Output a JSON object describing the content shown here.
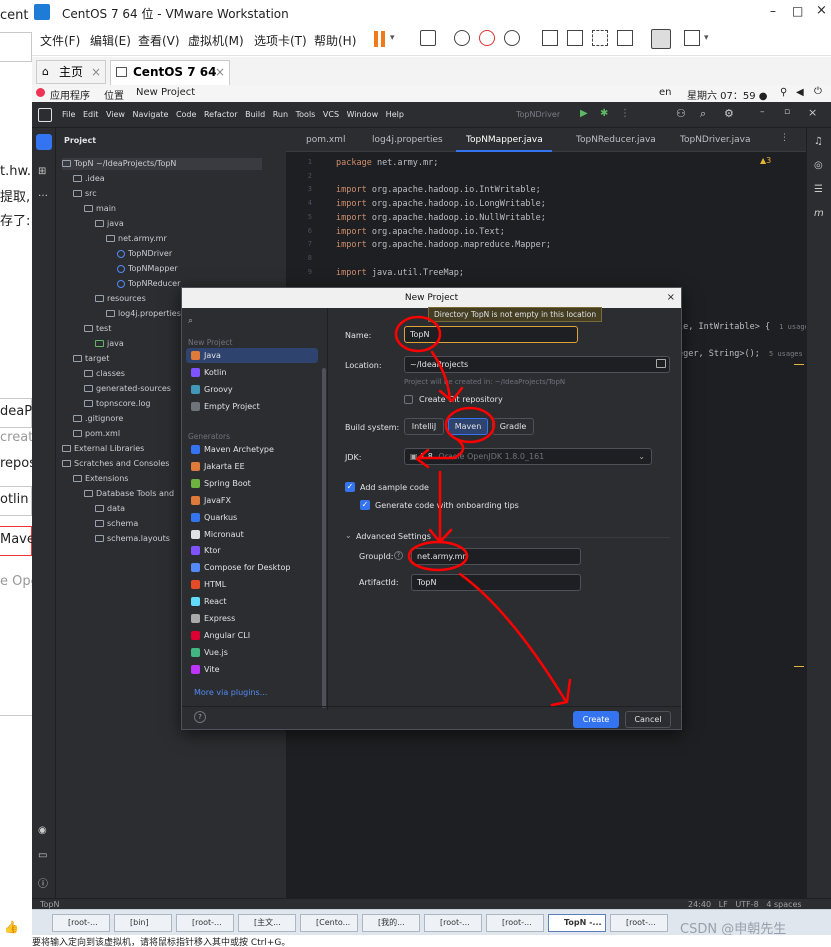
{
  "left_strip": {
    "texts": [
      "cent",
      "t.hw.",
      "提取,",
      "存了:",
      "deaPro",
      "creat",
      "repos",
      "otlin",
      "Maven",
      "e Ope"
    ]
  },
  "vmware": {
    "title": "CentOS 7 64 位 - VMware Workstation",
    "window_controls": [
      "–",
      "□",
      "×"
    ],
    "menu": [
      "文件(F)",
      "编辑(E)",
      "查看(V)",
      "虚拟机(M)",
      "选项卡(T)",
      "帮助(H)"
    ],
    "tabs": [
      {
        "label": "主页"
      },
      {
        "label": "CentOS 7 64 位",
        "active": true
      }
    ]
  },
  "gnome_bar": {
    "applications": "应用程序",
    "places": "位置",
    "active_app": "New Project",
    "lang": "en",
    "clock": "星期六 07：59 ●"
  },
  "idea": {
    "head_menu": [
      "File",
      "Edit",
      "View",
      "Navigate",
      "Code",
      "Refactor",
      "Build",
      "Run",
      "Tools",
      "VCS",
      "Window",
      "Help"
    ],
    "run_config": "TopNDriver",
    "project_title": "Project",
    "tree": [
      {
        "label": "TopN ~/IdeaProjects/TopN",
        "indent": 0,
        "kind": "folder"
      },
      {
        "label": ".idea",
        "indent": 1,
        "kind": "folder"
      },
      {
        "label": "src",
        "indent": 1,
        "kind": "folder"
      },
      {
        "label": "main",
        "indent": 2,
        "kind": "folder"
      },
      {
        "label": "java",
        "indent": 3,
        "kind": "folder"
      },
      {
        "label": "net.army.mr",
        "indent": 4,
        "kind": "package"
      },
      {
        "label": "TopNDriver",
        "indent": 5,
        "kind": "class"
      },
      {
        "label": "TopNMapper",
        "indent": 5,
        "kind": "class"
      },
      {
        "label": "TopNReducer",
        "indent": 5,
        "kind": "class"
      },
      {
        "label": "resources",
        "indent": 3,
        "kind": "folder"
      },
      {
        "label": "log4j.properties",
        "indent": 4,
        "kind": "file"
      },
      {
        "label": "test",
        "indent": 2,
        "kind": "folder"
      },
      {
        "label": "java",
        "indent": 3,
        "kind": "folder"
      },
      {
        "label": "target",
        "indent": 1,
        "kind": "folder"
      },
      {
        "label": "classes",
        "indent": 2,
        "kind": "folder"
      },
      {
        "label": "generated-sources",
        "indent": 2,
        "kind": "folder"
      },
      {
        "label": "topnscore.log",
        "indent": 2,
        "kind": "file"
      },
      {
        "label": ".gitignore",
        "indent": 1,
        "kind": "file"
      },
      {
        "label": "pom.xml",
        "indent": 1,
        "kind": "file"
      },
      {
        "label": "External Libraries",
        "indent": 0,
        "kind": "folder"
      },
      {
        "label": "Scratches and Consoles",
        "indent": 0,
        "kind": "folder"
      },
      {
        "label": "Extensions",
        "indent": 1,
        "kind": "folder"
      },
      {
        "label": "Database Tools and",
        "indent": 2,
        "kind": "folder"
      },
      {
        "label": "data",
        "indent": 3,
        "kind": "folder"
      },
      {
        "label": "schema",
        "indent": 3,
        "kind": "folder"
      },
      {
        "label": "schema.layouts",
        "indent": 3,
        "kind": "folder"
      }
    ],
    "editor_tabs": [
      {
        "label": "pom.xml"
      },
      {
        "label": "log4j.properties"
      },
      {
        "label": "TopNMapper.java",
        "active": true
      },
      {
        "label": "TopNReducer.java"
      },
      {
        "label": "TopNDriver.java"
      }
    ],
    "warnings": "▲3",
    "code_lines": [
      {
        "n": "1",
        "kw": "package",
        "rest": " net.army.mr;"
      },
      {
        "n": "2",
        "kw": "",
        "rest": ""
      },
      {
        "n": "3",
        "kw": "import",
        "rest": " org.apache.hadoop.io.IntWritable;"
      },
      {
        "n": "4",
        "kw": "import",
        "rest": " org.apache.hadoop.io.LongWritable;"
      },
      {
        "n": "5",
        "kw": "import",
        "rest": " org.apache.hadoop.io.NullWritable;"
      },
      {
        "n": "6",
        "kw": "import",
        "rest": " org.apache.hadoop.io.Text;"
      },
      {
        "n": "7",
        "kw": "import",
        "rest": " org.apache.hadoop.mapreduce.Mapper;"
      },
      {
        "n": "8",
        "kw": "",
        "rest": ""
      },
      {
        "n": "9",
        "kw": "import",
        "rest": " java.util.TreeMap;"
      }
    ],
    "code_right_1": "le, IntWritable> {",
    "code_right_1_usage": "1 usage",
    "code_right_2": "eger, String>();",
    "code_right_2_usage": "5 usages",
    "status_left": "TopN",
    "status_right": "24:40   LF   UTF-8   4 spaces"
  },
  "dialog": {
    "title": "New Project",
    "tooltip": "Directory TopN is not empty in this location",
    "section_new_project": "New Project",
    "project_types": [
      "Java",
      "Kotlin",
      "Groovy",
      "Empty Project"
    ],
    "section_generators": "Generators",
    "generators": [
      "Maven Archetype",
      "Jakarta EE",
      "Spring Boot",
      "JavaFX",
      "Quarkus",
      "Micronaut",
      "Ktor",
      "Compose for Desktop",
      "HTML",
      "React",
      "Express",
      "Angular CLI",
      "Vue.js",
      "Vite"
    ],
    "more_plugins": "More via plugins...",
    "name_label": "Name:",
    "name_value": "TopN",
    "location_label": "Location:",
    "location_value": "~/IdeaProjects",
    "location_hint": "Project will be created in: ~/IdeaProjects/TopN",
    "git_label": "Create Git repository",
    "build_label": "Build system:",
    "build_options": [
      "IntelliJ",
      "Maven",
      "Gradle"
    ],
    "build_selected": "Maven",
    "jdk_label": "JDK:",
    "jdk_version": "1.8",
    "jdk_detail": "Oracle OpenJDK 1.8.0_161",
    "sample_code_label": "Add sample code",
    "onboarding_label": "Generate code with onboarding tips",
    "advanced_label": "Advanced Settings",
    "groupid_label": "GroupId:",
    "groupid_value": "net.army.mr",
    "artifactid_label": "ArtifactId:",
    "artifactid_value": "TopN",
    "create_label": "Create",
    "cancel_label": "Cancel",
    "help": "?"
  },
  "taskbar": {
    "items": [
      "[root-...",
      "[bin]",
      "[root-...",
      "[主文...",
      "[Cento...",
      "[我的...",
      "[root-...",
      "[root-...",
      "TopN -...",
      "[root-..."
    ]
  },
  "bottom_text": "要将输入定向到该虚拟机，请将鼠标指针移入其中或按 Ctrl+G。",
  "watermark": "CSDN @申朝先生",
  "colors": {
    "ide_bg": "#1e1f22",
    "panel_bg": "#2b2d30",
    "accent_blue": "#3574f0",
    "selection_blue": "#2e436e",
    "annotation_red": "#ff0000",
    "keyword": "#cf8e6d"
  }
}
